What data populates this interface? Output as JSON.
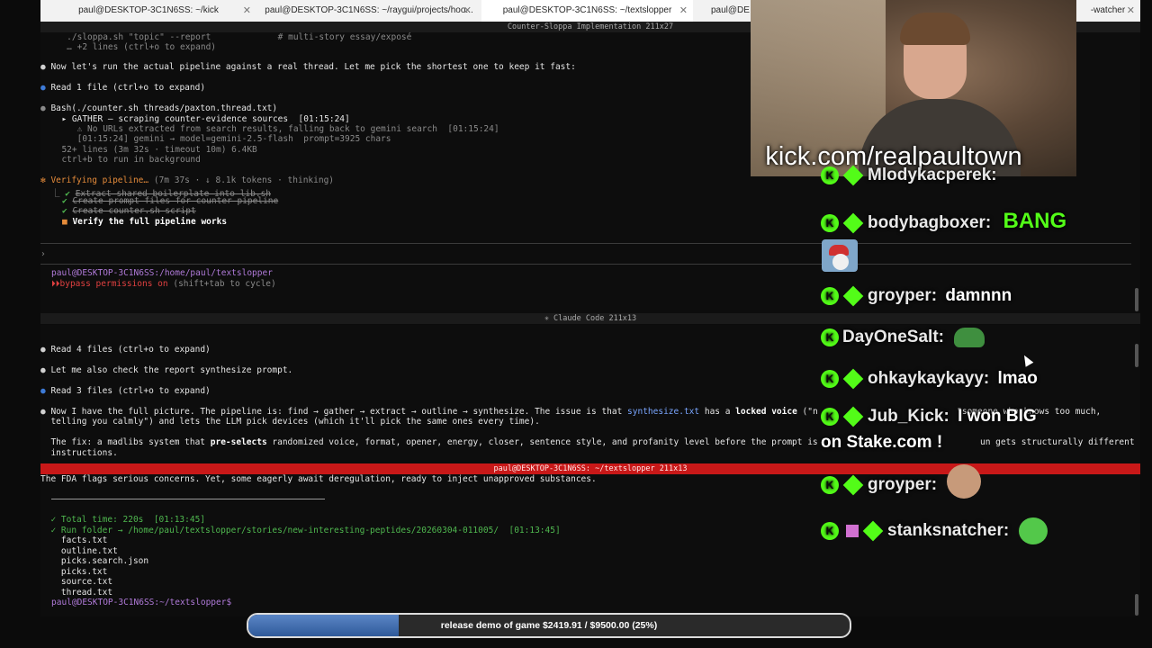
{
  "tabs": [
    {
      "label": "paul@DESKTOP-3C1N6SS: ~/kick"
    },
    {
      "label": "paul@DESKTOP-3C1N6SS: ~/raygui/projects/hoo..."
    },
    {
      "label": "paul@DESKTOP-3C1N6SS: ~/textslopper"
    },
    {
      "label": "paul@DE"
    },
    {
      "label": "-watcher"
    }
  ],
  "pane1": {
    "title": "Counter-Sloppa Implementation 211x27",
    "lines": {
      "l1": "   ./sloppa.sh \"topic\" --report             # multi-story essay/exposé",
      "l2": "   … +2 lines (ctrl+o to expand)",
      "l3": "Now let's run the actual pipeline against a real thread. Let me pick the shortest one to keep it fast:",
      "l4": "Read 1 file (ctrl+o to expand)",
      "l5": "Bash(./counter.sh threads/paxton.thread.txt)",
      "l6": "  ▸ GATHER — scraping counter-evidence sources  [01:15:24]",
      "l7": "     ⚠ No URLs extracted from search results, falling back to gemini search  [01:15:24]",
      "l8": "     [01:15:24] gemini → model=gemini-2.5-flash  prompt=3925 chars",
      "l9": "  52+ lines (3m 32s · timeout 10m) 6.4KB",
      "l10": "  ctrl+b to run in background",
      "l11": "Verifying pipeline…",
      "l11b": " (7m 37s · ↓ 8.1k tokens · thinking)",
      "l12": "Extract shared boilerplate into lib.sh",
      "l13": "Create prompt files for counter pipeline",
      "l14": "Create counter.sh script",
      "l15": "Verify the full pipeline works",
      "prompt": "›",
      "user": "paul@DESKTOP-3C1N6SS",
      "path": ":/home/paul/textslopper",
      "bypass": "bypass permissions on",
      "bypass_hint": " (shift+tab to cycle)"
    }
  },
  "pane2": {
    "title": "✳ Claude Code 211x13",
    "lines": {
      "l1": "Read 4 files (ctrl+o to expand)",
      "l2": "Let me also check the report synthesize prompt.",
      "l3": "Read 3 files (ctrl+o to expand)",
      "l4a": "Now I have the full picture. The pipeline is: find → gather → extract → outline → synthesize. The issue is that ",
      "l4b": "synthesize.txt",
      "l4c": " has a ",
      "l4d": "locked voice",
      "l4e": " (\"n",
      "l4f": "                           \"someone who knows too much,",
      "l5": "  telling you calmly\") and lets the LLM pick devices (which it'll pick the same ones every time).",
      "l6a": "  The fix: a madlibs system that ",
      "l6b": "pre-selects",
      "l6c": " randomized voice, format, opener, energy, closer, sentence style, and profanity level before the prompt is",
      "l6d": "un gets structurally different",
      "l7": "  instructions."
    }
  },
  "pane3": {
    "title": "paul@DESKTOP-3C1N6SS: ~/textslopper 211x13",
    "lines": {
      "l1": "The FDA flags serious concerns. Yet, some eagerly await deregulation, ready to inject unapproved substances.",
      "l2": "  ✓ Total time: 220s  [01:13:45]",
      "l3": "  ✓ Run folder → /home/paul/textslopper/stories/new-interesting-peptides/20260304-011005/  [01:13:45]",
      "f1": "    facts.txt",
      "f2": "    outline.txt",
      "f3": "    picks.search.json",
      "f4": "    picks.txt",
      "f5": "    source.txt",
      "f6": "    thread.txt",
      "prompt": "paul@DESKTOP-3C1N6SS:~/textslopper$"
    }
  },
  "stream": {
    "url": "kick.com/realpaultown",
    "chat": [
      {
        "name": "Mlodykacperek:",
        "msg": ""
      },
      {
        "name": "bodybagboxer:",
        "msg": "BANG"
      },
      {
        "name": "groyper:",
        "msg": "damnnn"
      },
      {
        "name": "DayOneSalt:",
        "msg": ""
      },
      {
        "name": "ohkaykaykayy:",
        "msg": "lmao"
      },
      {
        "name": "Jub_Kick:",
        "msg": "I won BIG"
      },
      {
        "name": "",
        "msg": "on Stake.com !"
      },
      {
        "name": "groyper:",
        "msg": ""
      },
      {
        "name": "stanksnatcher:",
        "msg": ""
      }
    ],
    "badge_letter": "K"
  },
  "goal": {
    "label": "release demo of game $2419.91 / $9500.00 (25%)",
    "progress": 0.25
  },
  "colors": {
    "kick_green": "#53fc18",
    "active_pane_red": "#c81818",
    "progress_blue": "#3f6eb3"
  }
}
